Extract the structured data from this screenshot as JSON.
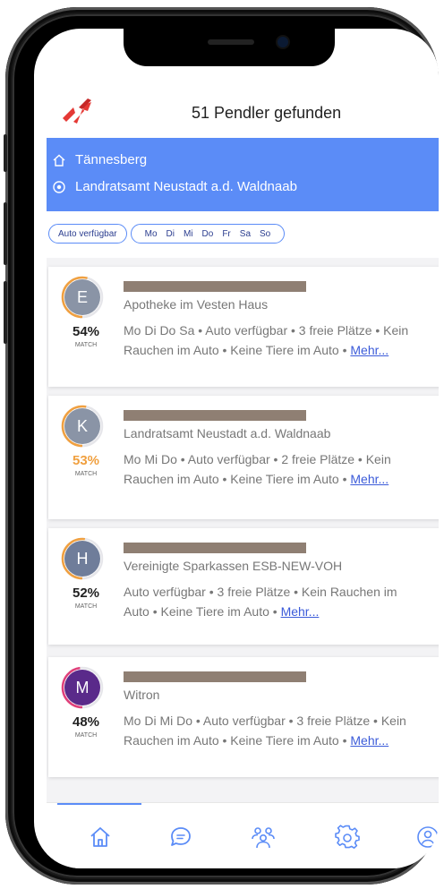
{
  "header": {
    "title": "51 Pendler gefunden"
  },
  "route": {
    "from": "Tännesberg",
    "to": "Landratsamt Neustadt a.d. Waldnaab"
  },
  "filters": {
    "car": "Auto verfügbar",
    "days": [
      "Mo",
      "Di",
      "Mi",
      "Do",
      "Fr",
      "Sa",
      "So"
    ]
  },
  "matches": [
    {
      "initial": "E",
      "company": "Apotheke im Vesten Haus",
      "percent": "54%",
      "match_label": "MATCH",
      "line1": "Mo Di Do Sa • Auto verfügbar • 3 freie Plätze • Kein",
      "line2": "Rauchen im Auto • Keine Tiere im Auto • ",
      "more": "Mehr...",
      "avatar_color": "#8a94a6",
      "ring_color": "#f0a040",
      "ring_fraction": 0.54,
      "percent_color": "#222222"
    },
    {
      "initial": "K",
      "company": "Landratsamt Neustadt a.d. Waldnaab",
      "percent": "53%",
      "match_label": "MATCH",
      "line1": "Mo Mi Do • Auto verfügbar • 2 freie Plätze • Kein",
      "line2": "Rauchen im Auto • Keine Tiere im Auto • ",
      "more": "Mehr...",
      "avatar_color": "#8a94a6",
      "ring_color": "#f0a040",
      "ring_fraction": 0.53,
      "percent_color": "#f0a040"
    },
    {
      "initial": "H",
      "company": "Vereinigte Sparkassen ESB-NEW-VOH",
      "percent": "52%",
      "match_label": "MATCH",
      "line1": "Auto verfügbar • 3 freie Plätze • Kein Rauchen im",
      "line2": "Auto • Keine Tiere im Auto • ",
      "more": "Mehr...",
      "avatar_color": "#6f7d9a",
      "ring_color": "#f0a040",
      "ring_fraction": 0.52,
      "percent_color": "#222222"
    },
    {
      "initial": "M",
      "company": "Witron",
      "percent": "48%",
      "match_label": "MATCH",
      "line1": "Mo Di Mi Do • Auto verfügbar • 3 freie Plätze • Kein",
      "line2": "Rauchen im Auto • Keine Tiere im Auto • ",
      "more": "Mehr...",
      "avatar_color": "#5a2a8a",
      "ring_color": "#e0407a",
      "ring_fraction": 0.48,
      "percent_color": "#222222"
    }
  ],
  "tabs": [
    "home-icon",
    "chat-icon",
    "people-icon",
    "settings-icon",
    "profile-icon"
  ],
  "colors": {
    "accent": "#5b8cf7",
    "logo": "#e53935"
  }
}
